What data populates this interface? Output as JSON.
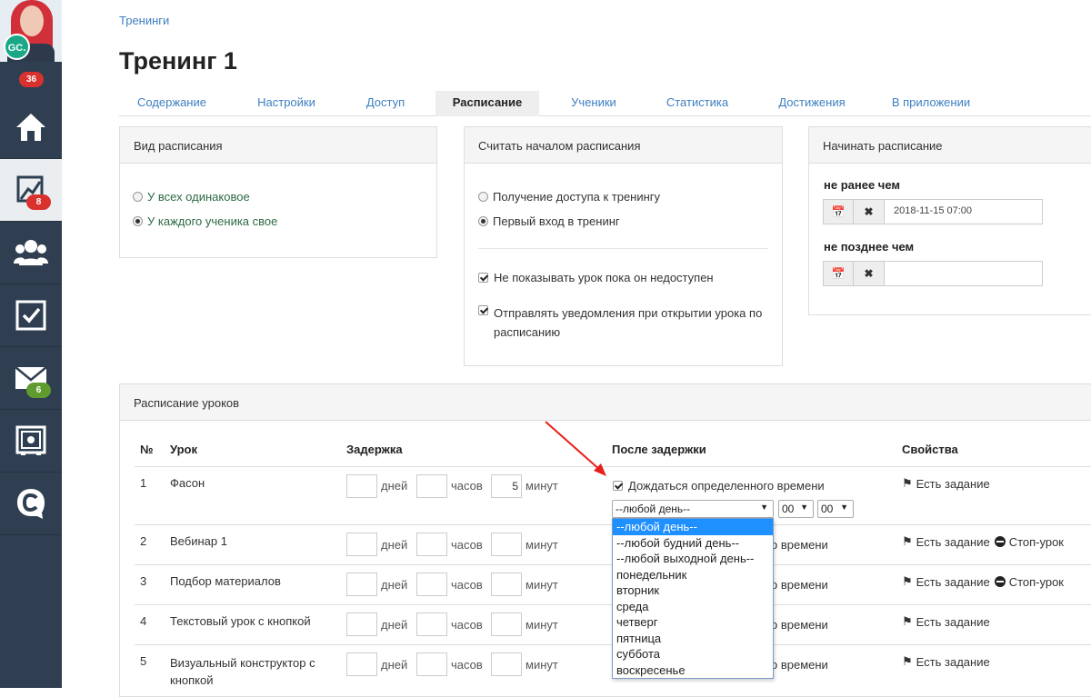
{
  "sidebar": {
    "avatar_initials": "GC.",
    "top_count": "36",
    "items": [
      {
        "icon": "home-icon",
        "badge": ""
      },
      {
        "icon": "chart-icon",
        "badge": "8",
        "badge_color": "#d9322e"
      },
      {
        "icon": "users-icon",
        "badge": ""
      },
      {
        "icon": "tasks-icon",
        "badge": ""
      },
      {
        "icon": "mail-icon",
        "badge": "6",
        "badge_color": "#5f9b2f"
      },
      {
        "icon": "safe-icon",
        "badge": ""
      },
      {
        "icon": "chat-icon",
        "badge": ""
      }
    ]
  },
  "breadcrumb": "Тренинги",
  "page_title": "Тренинг 1",
  "tabs": [
    "Содержание",
    "Настройки",
    "Доступ",
    "Расписание",
    "Ученики",
    "Статистика",
    "Достижения",
    "В приложении"
  ],
  "active_tab": "Расписание",
  "schedule_type": {
    "title": "Вид расписания",
    "options": [
      "У всех одинаковое",
      "У каждого ученика свое"
    ],
    "selected": 1
  },
  "schedule_start": {
    "title": "Считать началом расписания",
    "options": [
      "Получение доступа к тренингу",
      "Первый вход в тренинг"
    ],
    "selected": 1,
    "checkboxes": [
      "Не показывать урок пока он недоступен",
      "Отправлять уведомления при открытии урока по расписанию"
    ]
  },
  "start_schedule": {
    "title": "Начинать расписание",
    "not_before_label": "не ранее чем",
    "not_before_value": "2018-11-15 07:00",
    "not_after_label": "не позднее чем",
    "not_after_value": ""
  },
  "lessons": {
    "title": "Расписание уроков",
    "columns": [
      "№",
      "Урок",
      "Задержка",
      "После задержки",
      "Свойства"
    ],
    "units": {
      "days": "дней",
      "hours": "часов",
      "minutes": "минут"
    },
    "wait_label": "Дождаться определенного времени",
    "wait_partial": "о времени",
    "prop_task": "Есть задание",
    "prop_stop": "Стоп-урок",
    "rows": [
      {
        "num": "1",
        "name": "Фасон",
        "minutes": "5",
        "stop": false
      },
      {
        "num": "2",
        "name": "Вебинар 1",
        "minutes": "",
        "stop": true
      },
      {
        "num": "3",
        "name": "Подбор материалов",
        "minutes": "",
        "stop": true
      },
      {
        "num": "4",
        "name": "Текстовый урок с кнопкой",
        "minutes": "",
        "stop": false
      },
      {
        "num": "5",
        "name": "Визуальный конструктор с кнопкой",
        "minutes": "",
        "stop": false
      }
    ],
    "day_select": "--любой день--",
    "hour_select": "00",
    "minute_select": "00",
    "day_options": [
      "--любой день--",
      "--любой будний день--",
      "--любой выходной день--",
      "понедельник",
      "вторник",
      "среда",
      "четверг",
      "пятница",
      "суббота",
      "воскресенье"
    ]
  }
}
